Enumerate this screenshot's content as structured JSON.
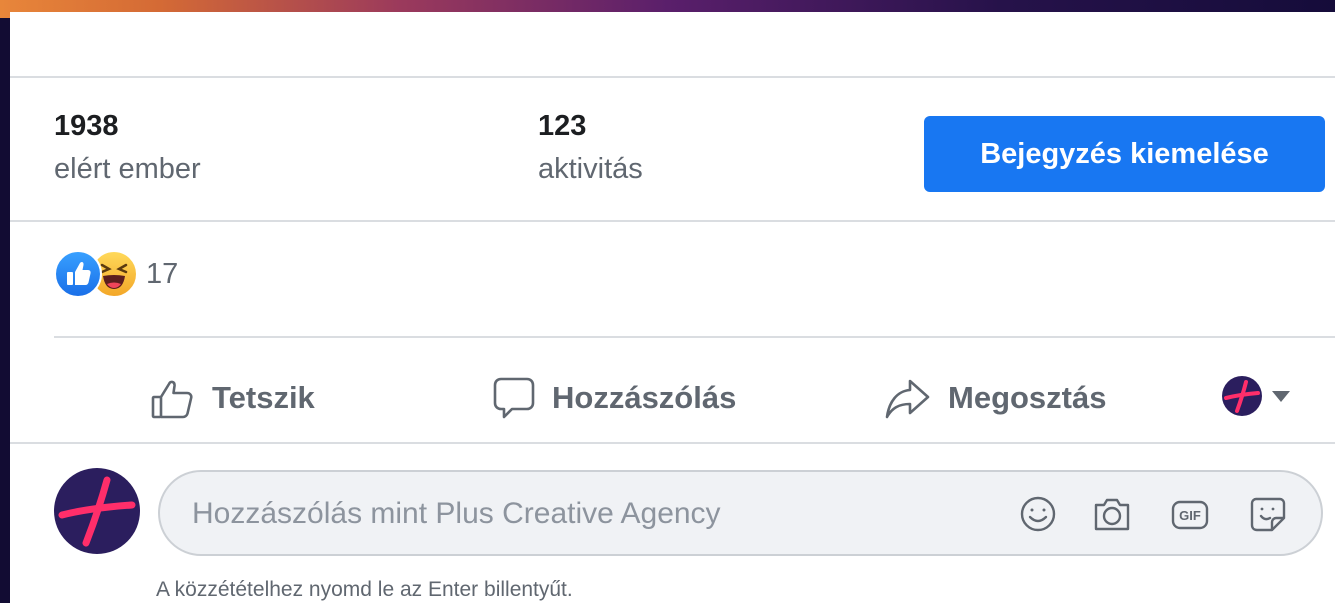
{
  "stats": {
    "reach": {
      "value": "1938",
      "label": "elért ember"
    },
    "engagement": {
      "value": "123",
      "label": "aktivitás"
    }
  },
  "boost_button": {
    "label": "Bejegyzés kiemelése"
  },
  "reactions": {
    "count": "17",
    "types": [
      "like-icon",
      "haha-icon"
    ]
  },
  "actions": {
    "like": "Tetszik",
    "comment": "Hozzászólás",
    "share": "Megosztás"
  },
  "comment": {
    "placeholder": "Hozzászólás mint Plus Creative Agency",
    "hint": "A közzétételhez nyomd le az Enter billentyűt.",
    "tools": [
      "emoji-icon",
      "camera-icon",
      "gif-icon",
      "sticker-icon"
    ],
    "gif_label": "GIF"
  },
  "colors": {
    "accent": "#1877f2",
    "avatar_bg": "#2b1e5e",
    "avatar_mark": "#ff2e6a"
  }
}
